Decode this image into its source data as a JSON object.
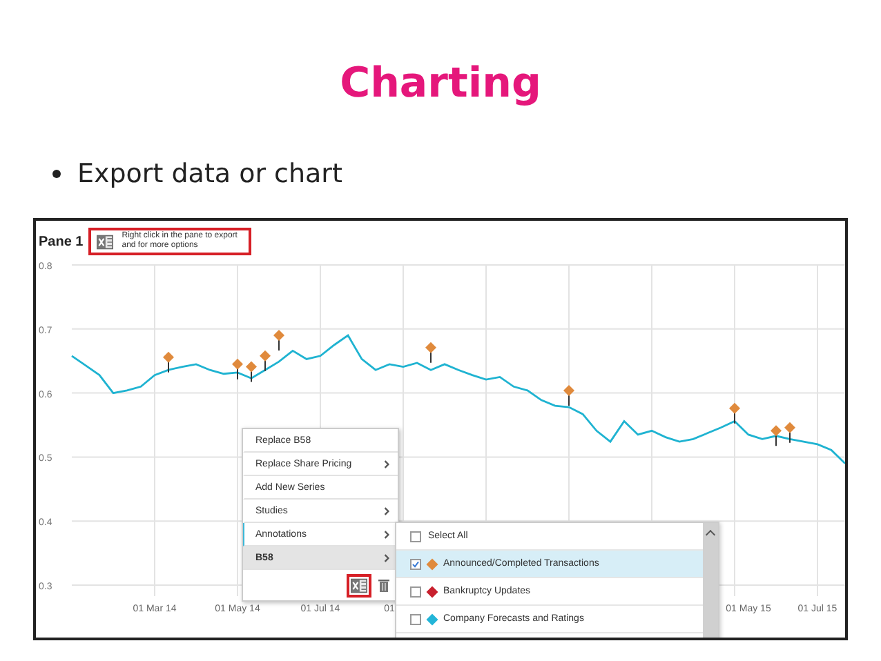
{
  "slide": {
    "title": "Charting",
    "bullets": [
      "Export data or chart"
    ]
  },
  "pane": {
    "title": "Pane 1",
    "tip": "Right click in the pane to export and for more options",
    "chart_data": {
      "type": "line",
      "grid": true,
      "ylim": [
        0.3,
        0.8
      ],
      "yticks": [
        0.3,
        0.4,
        0.5,
        0.6,
        0.7,
        0.8
      ],
      "categories": [
        null,
        null,
        null,
        null,
        null,
        null,
        "01 Mar 14",
        null,
        null,
        null,
        null,
        null,
        "01 May 14",
        null,
        null,
        null,
        null,
        null,
        "01 Jul 14",
        null,
        null,
        null,
        null,
        "01",
        null,
        null,
        null,
        null,
        null,
        null,
        null,
        null,
        null,
        null,
        null,
        null,
        null,
        null,
        null,
        null,
        null,
        null,
        null,
        null,
        null,
        null,
        null,
        null,
        null,
        "01 May 15",
        null,
        null,
        null,
        null,
        "01 Jul 15",
        null,
        null
      ],
      "series": [
        {
          "color": "#1fb3d1",
          "values": [
            0.658,
            0.643,
            0.628,
            0.6,
            0.604,
            0.61,
            0.628,
            0.636,
            0.641,
            0.645,
            0.636,
            0.63,
            0.632,
            0.623,
            0.636,
            0.649,
            0.666,
            0.653,
            0.658,
            0.675,
            0.69,
            0.653,
            0.636,
            0.645,
            0.641,
            0.647,
            0.636,
            0.645,
            0.636,
            0.628,
            0.621,
            0.625,
            0.61,
            0.604,
            0.589,
            0.58,
            0.578,
            0.567,
            0.541,
            0.524,
            0.556,
            0.535,
            0.541,
            0.531,
            0.524,
            0.528,
            0.537,
            0.546,
            0.556,
            0.535,
            0.528,
            0.533,
            0.528,
            0.524,
            0.52,
            0.511,
            0.49
          ]
        },
        {
          "type": "scatter",
          "color": "#e08a3c",
          "values": [
            null,
            null,
            null,
            null,
            null,
            null,
            null,
            0.656,
            null,
            null,
            null,
            null,
            0.645,
            0.641,
            0.658,
            0.69,
            null,
            null,
            null,
            null,
            null,
            null,
            null,
            null,
            null,
            null,
            0.671,
            null,
            null,
            null,
            null,
            null,
            null,
            null,
            null,
            null,
            0.604,
            null,
            null,
            null,
            null,
            null,
            null,
            null,
            null,
            null,
            null,
            null,
            0.576,
            null,
            null,
            0.541,
            0.546,
            null,
            null,
            null,
            null
          ]
        }
      ]
    }
  },
  "context_menu": {
    "items": [
      {
        "label": "Replace B58",
        "has_submenu": false,
        "open": false,
        "selected": false
      },
      {
        "label": "Replace Share Pricing",
        "has_submenu": true,
        "open": false,
        "selected": false
      },
      {
        "label": "Add New Series",
        "has_submenu": false,
        "open": false,
        "selected": false
      },
      {
        "label": "Studies",
        "has_submenu": true,
        "open": false,
        "selected": false
      },
      {
        "label": "Annotations",
        "has_submenu": true,
        "open": true,
        "selected": false
      },
      {
        "label": "B58",
        "has_submenu": true,
        "open": false,
        "selected": true
      }
    ]
  },
  "submenu": {
    "items": [
      {
        "kind": "all",
        "label": "Select All",
        "checked": false,
        "selected": false
      },
      {
        "kind": "series",
        "label": "Announced/Completed Transactions",
        "checked": true,
        "selected": true,
        "color": "#e08a3c"
      },
      {
        "kind": "series",
        "label": "Bankruptcy Updates",
        "checked": false,
        "selected": false,
        "color": "#c8202e"
      },
      {
        "kind": "series",
        "label": "Company Forecasts and Ratings",
        "checked": false,
        "selected": false,
        "color": "#23b5d8"
      }
    ]
  }
}
